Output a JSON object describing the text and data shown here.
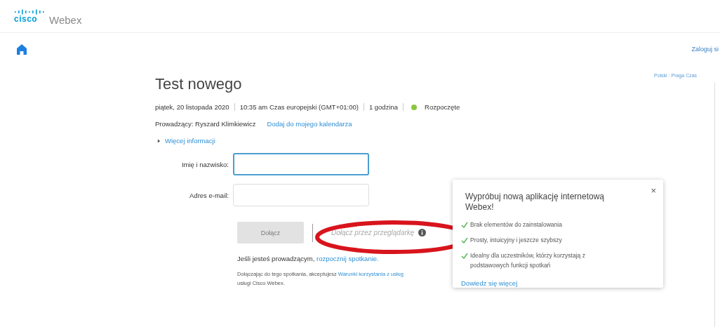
{
  "header": {
    "logo_mark": "cisco",
    "product": "Webex"
  },
  "nav": {
    "sign_in": "Zaloguj si",
    "locale": "Polski : Praga Czas"
  },
  "meeting": {
    "title": "Test nowego",
    "details": [
      "piątek, 20 listopada 2020",
      "10:35 am Czas europejski (GMT+01:00)",
      "1 godzina"
    ],
    "status": {
      "label": "Rozpoczęte",
      "color": "#8cc63f"
    },
    "host": "Prowadzący: Ryszard Klimkiewicz",
    "add_calendar": "Dodaj do mojego kalendarza",
    "more_info": {
      "label": "Więcej informacji",
      "expanded": false
    }
  },
  "form": {
    "fields": [
      {
        "label": "Imię i nazwisko:",
        "focused": true
      },
      {
        "label": "Adres e-mail:",
        "focused": false
      }
    ],
    "join_button": {
      "label": "Dołącz",
      "disabled": true
    },
    "browser_join": "Dołącz przez przeglądarkę",
    "host_note": {
      "text": "Jeśli jesteś prowadzącym, ",
      "link": "rozpocznij spotkanie."
    },
    "terms": {
      "text": "Dołączając do tego spotkania, akceptujesz ",
      "link": "Warunki korzystania z usług",
      "text_after": "usługi Cisco Webex."
    }
  },
  "popup": {
    "title": "Wypróbuj nową aplikację internetową Webex!",
    "close": "×",
    "features": [
      "Brak elementów do zainstalowania",
      "Prosty, intuicyjny i jeszcze szybszy",
      "Idealny dla uczestników, którzy korzystają z podstawowych funkcji spotkań"
    ],
    "link": "Dowiedz się więcej"
  }
}
